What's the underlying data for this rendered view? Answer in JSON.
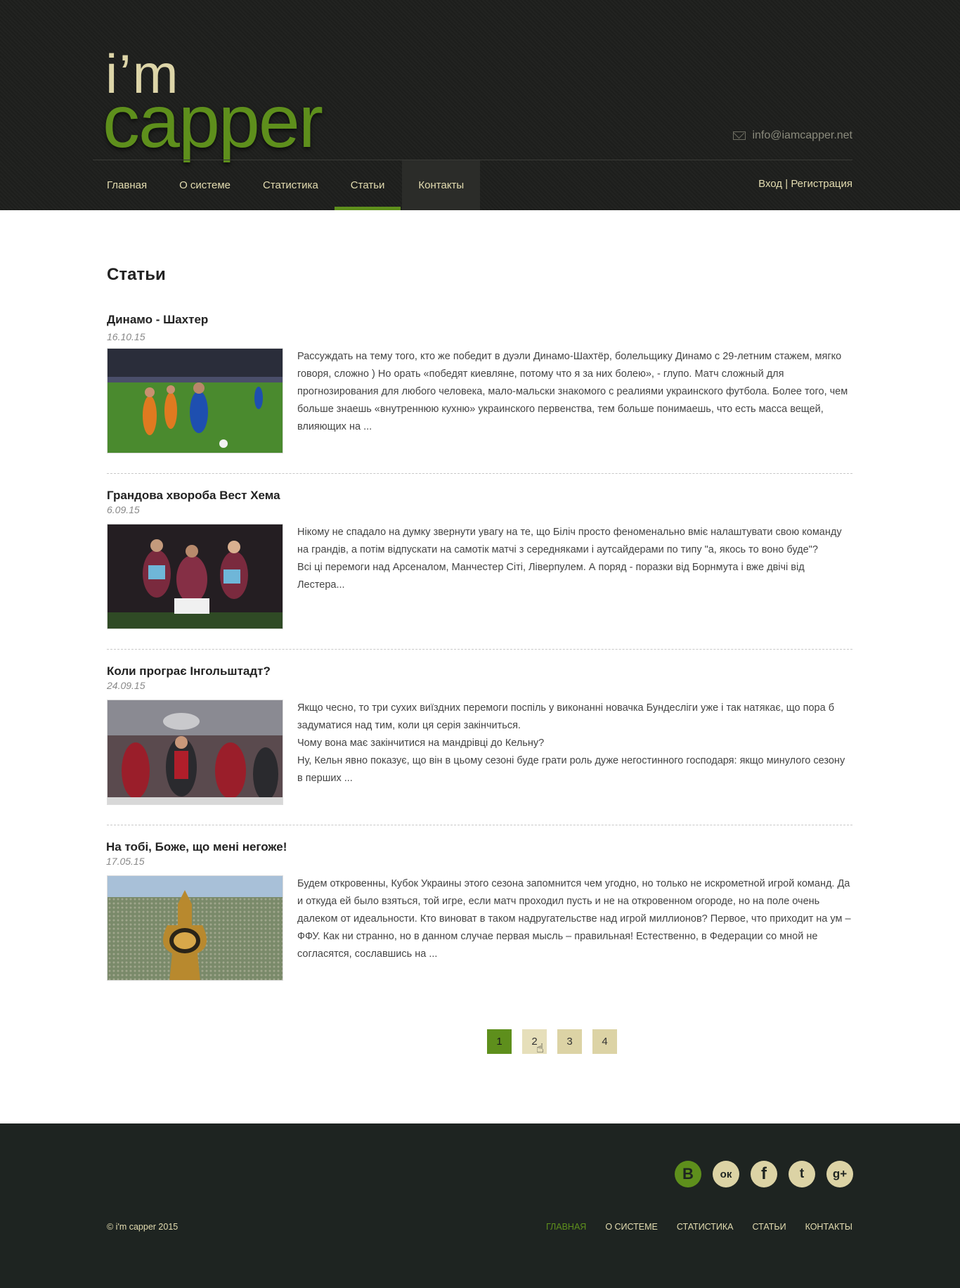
{
  "header": {
    "logo_top": "i’m",
    "logo_bottom": "capper",
    "email": "info@iamcapper.net",
    "nav": [
      {
        "label": "Главная"
      },
      {
        "label": "О системе"
      },
      {
        "label": "Статистика"
      },
      {
        "label": "Статьи"
      },
      {
        "label": "Контакты"
      }
    ],
    "login": "Вход",
    "auth_separator": "|",
    "register": "Регистрация"
  },
  "main": {
    "title": "Статьи",
    "articles": [
      {
        "title": "Динамо - Шахтер",
        "date": "16.10.15",
        "excerpt": "Рассуждать на тему того, кто же победит в дуэли Динамо-Шахтёр, болельщику Динамо с 29-летним стажем, мягко говоря, сложно ) Но орать «победят киевляне, потому что я за них болею», - глупо. Матч сложный для прогнозирования для любого человека, мало-мальски знакомого с реалиями украинского футбола. Более того, чем больше знаешь «внутреннюю кухню» украинского первенства, тем больше понимаешь, что есть масса вещей, влияющих на ..."
      },
      {
        "title": "Грандова хвороба Вест Хема",
        "date": "6.09.15",
        "excerpt_lines": [
          "Нікому не спадало на думку звернути увагу на те, що Біліч просто феноменально вміє налаштувати свою команду на грандів, а потім відпускати на самотік матчі з середняками і аутсайдерами по типу \"а, якось то воно буде\"?",
          "Всі ці перемоги над Арсеналом, Манчестер Сіті, Ліверпулем. А поряд - поразки від Борнмута і вже двічі від Лестера..."
        ]
      },
      {
        "title": "Коли програє Інгольштадт?",
        "date": "24.09.15",
        "excerpt_lines": [
          "Якщо чесно, то три сухих виїздних перемоги поспіль у виконанні новачка Бундесліги уже і так натякає, що пора б задуматися над тим, коли ця серія закінчиться.",
          "Чому вона має закінчитися на мандрівці до Кельну?",
          "Ну, Кельн явно показує, що він в цьому сезоні буде грати роль дуже негостинного господаря: якщо минулого сезону в перших ..."
        ]
      },
      {
        "title": "На тобі, Боже, що мені негоже!",
        "date": "17.05.15",
        "excerpt": "Будем откровенны, Кубок Украины этого сезона запомнится чем угодно, но только не искрометной игрой команд. Да и откуда ей было взяться, той игре, если матч проходил пусть и не на откровенном огороде, но на поле очень далеком от идеальности. Кто виноват в таком надругательстве над игрой миллионов? Первое, что приходит на ум – ФФУ. Как ни странно, но в данном случае первая мысль – правильная! Естественно, в Федерации со мной не согласятся, сославшись на ..."
      }
    ],
    "pagination": [
      "1",
      "2",
      "3",
      "4"
    ]
  },
  "footer": {
    "social": [
      {
        "icon": "vk-icon",
        "glyph": "В"
      },
      {
        "icon": "odnoklassniki-icon",
        "glyph": "ок"
      },
      {
        "icon": "facebook-icon",
        "glyph": "f"
      },
      {
        "icon": "twitter-icon",
        "glyph": "t"
      },
      {
        "icon": "google-plus-icon",
        "glyph": "g+"
      }
    ],
    "copyright": "© i'm capper 2015",
    "nav": [
      {
        "label": "ГЛАВНАЯ"
      },
      {
        "label": "О СИСТЕМЕ"
      },
      {
        "label": "СТАТИСТИКА"
      },
      {
        "label": "СТАТЬИ"
      },
      {
        "label": "КОНТАКТЫ"
      }
    ]
  },
  "colors": {
    "accent_green": "#5e8f1c",
    "beige": "#dcd3a5",
    "header_bg": "#1e1f1d",
    "footer_bg": "#1e2421"
  }
}
